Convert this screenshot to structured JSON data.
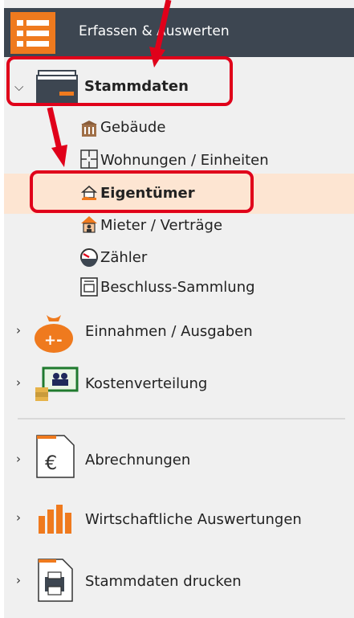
{
  "header": {
    "title": "Erfassen & Auswerten"
  },
  "sections": {
    "stammdaten": {
      "label": "Stammdaten",
      "items": [
        {
          "label": "Gebäude",
          "icon": "building-icon"
        },
        {
          "label": "Wohnungen / Einheiten",
          "icon": "floorplan-icon"
        },
        {
          "label": "Eigentümer",
          "icon": "owner-icon"
        },
        {
          "label": "Mieter / Verträge",
          "icon": "tenant-house-icon"
        },
        {
          "label": "Zähler",
          "icon": "meter-gauge-icon"
        },
        {
          "label": "Beschluss-Sammlung",
          "icon": "resolution-document-icon"
        }
      ]
    },
    "einnahmen": {
      "label": "Einnahmen / Ausgaben",
      "icon": "money-bag-icon"
    },
    "kosten": {
      "label": "Kostenverteilung",
      "icon": "cost-distribution-icon"
    },
    "abrechnungen": {
      "label": "Abrechnungen",
      "icon": "euro-document-icon"
    },
    "wirtschaft": {
      "label": "Wirtschaftliche Auswertungen",
      "icon": "bar-chart-icon"
    },
    "drucken": {
      "label": "Stammdaten drucken",
      "icon": "printer-icon"
    }
  },
  "colors": {
    "accent": "#ef7a1e",
    "header_bg": "#3d4651",
    "selected_bg": "#fde5d2",
    "annotation_red": "#e0001a"
  }
}
